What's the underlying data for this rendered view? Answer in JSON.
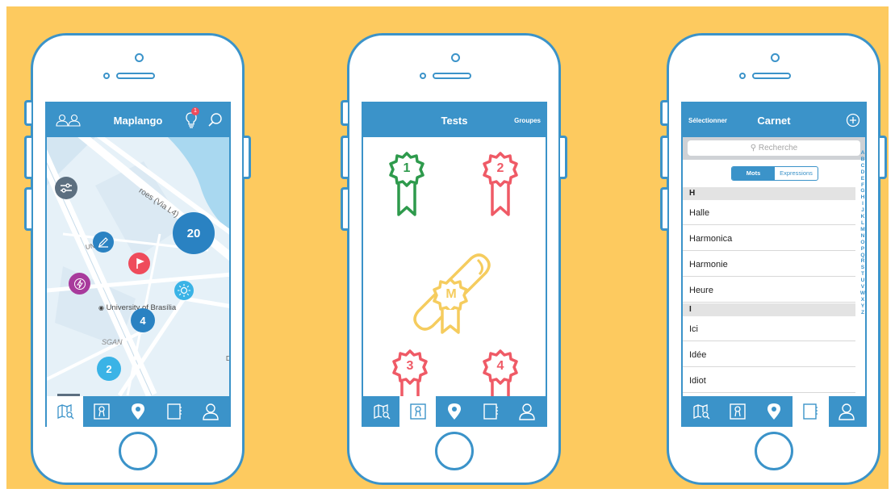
{
  "colors": {
    "background": "#fdca5f",
    "primary": "#3b93c9",
    "map_water": "#a9d8f0",
    "map_land": "#e6f1f8",
    "green": "#2e9a4c",
    "red": "#ef5a66",
    "yellow": "#f5cc5e",
    "purple": "#a83a9c",
    "cluster": "#2a82c2",
    "cluster_light": "#3ab3e6"
  },
  "screens": {
    "map": {
      "title": "Maplango",
      "notification_badge": "1",
      "map_labels": {
        "road1": "roes (Via L4)",
        "road2": "UN",
        "place": "University of Brasília",
        "district": "SGAN",
        "edge": "D"
      },
      "clusters": [
        "20",
        "4",
        "2"
      ],
      "icons": [
        "groups-icon",
        "bulb-icon",
        "search-icon",
        "filter-icon",
        "pencil-icon",
        "flag-icon",
        "lightning-icon",
        "sun-icon",
        "sun-icon",
        "navigation-icon",
        "location-arrow-icon"
      ]
    },
    "tests": {
      "title": "Tests",
      "right_action": "Groupes",
      "badges": [
        "1",
        "2",
        "M",
        "3",
        "4"
      ]
    },
    "carnet": {
      "title": "Carnet",
      "left_action": "Sélectionner",
      "search_placeholder": "Recherche",
      "segments": [
        "Mots",
        "Expressions"
      ],
      "active_segment": "Mots",
      "sections": [
        {
          "letter": "H",
          "words": [
            "Halle",
            "Harmonica",
            "Harmonie",
            "Heure"
          ]
        },
        {
          "letter": "I",
          "words": [
            "Ici",
            "Idée",
            "Idiot"
          ]
        }
      ],
      "index": [
        "A",
        "B",
        "C",
        "D",
        "E",
        "F",
        "G",
        "H",
        "I",
        "J",
        "K",
        "L",
        "M",
        "N",
        "O",
        "P",
        "Q",
        "R",
        "S",
        "T",
        "U",
        "V",
        "W",
        "X",
        "Y",
        "Z"
      ]
    }
  },
  "tabbar": {
    "icons": [
      "map-search-icon",
      "badge-icon",
      "location-pin-icon",
      "notebook-icon",
      "profile-icon"
    ],
    "active_per_screen": [
      "map-search-icon",
      "badge-icon",
      "notebook-icon"
    ]
  }
}
